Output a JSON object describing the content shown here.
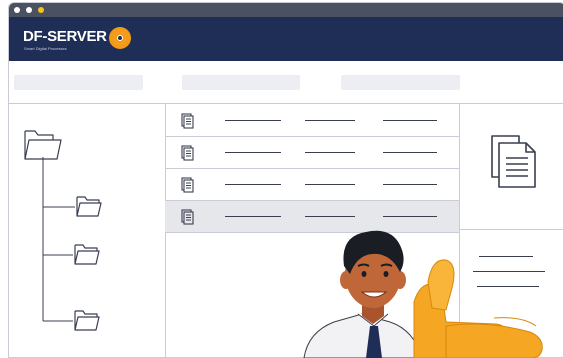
{
  "window": {
    "controls": [
      "close-dot",
      "minimize-dot",
      "maximize-dot"
    ],
    "control_colors": [
      "#ffffff",
      "#ffffff",
      "#f5c518"
    ]
  },
  "app": {
    "logo_text": "DF-SERVER",
    "tagline": "Smart Digital Processes",
    "brand_color": "#1f2e57",
    "accent_color": "#f39a16"
  },
  "toolbar": {
    "placeholders": [
      "",
      "",
      ""
    ]
  },
  "tree": {
    "icons": [
      "folder-open-icon",
      "folder-icon",
      "folder-icon",
      "folder-icon"
    ]
  },
  "list": {
    "rows": [
      {
        "icon": "document-icon",
        "selected": false
      },
      {
        "icon": "document-icon",
        "selected": false
      },
      {
        "icon": "document-icon",
        "selected": false
      },
      {
        "icon": "document-icon",
        "selected": true
      }
    ]
  },
  "preview": {
    "icon": "documents-icon"
  }
}
